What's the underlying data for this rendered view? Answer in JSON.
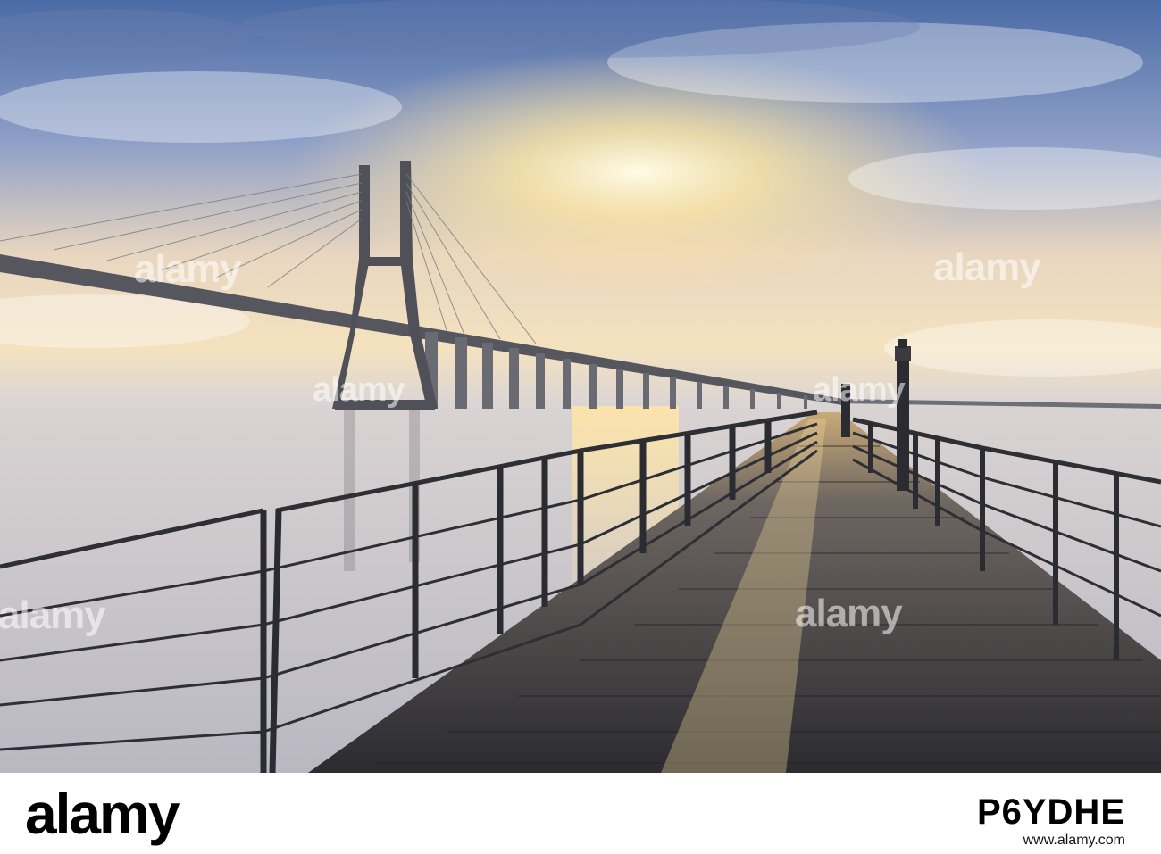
{
  "photo": {
    "subject": "",
    "colors": {
      "sky_top": "#4d6fa6",
      "sky_mid": "#b8bdd6",
      "sun_glow": "#fff3c4",
      "water": "#c9c7cf",
      "deck": "#3a3a40",
      "rail": "#2f3034"
    }
  },
  "watermarks": {
    "top_left": "alamy",
    "top_right": "alamy",
    "middle_left": "alamy",
    "center": "alamy",
    "mid_right": "alamy",
    "center_right": "alamy"
  },
  "footer": {
    "logo": "alamy",
    "stock_id": "P6YDHE",
    "site": "www.alamy.com"
  }
}
